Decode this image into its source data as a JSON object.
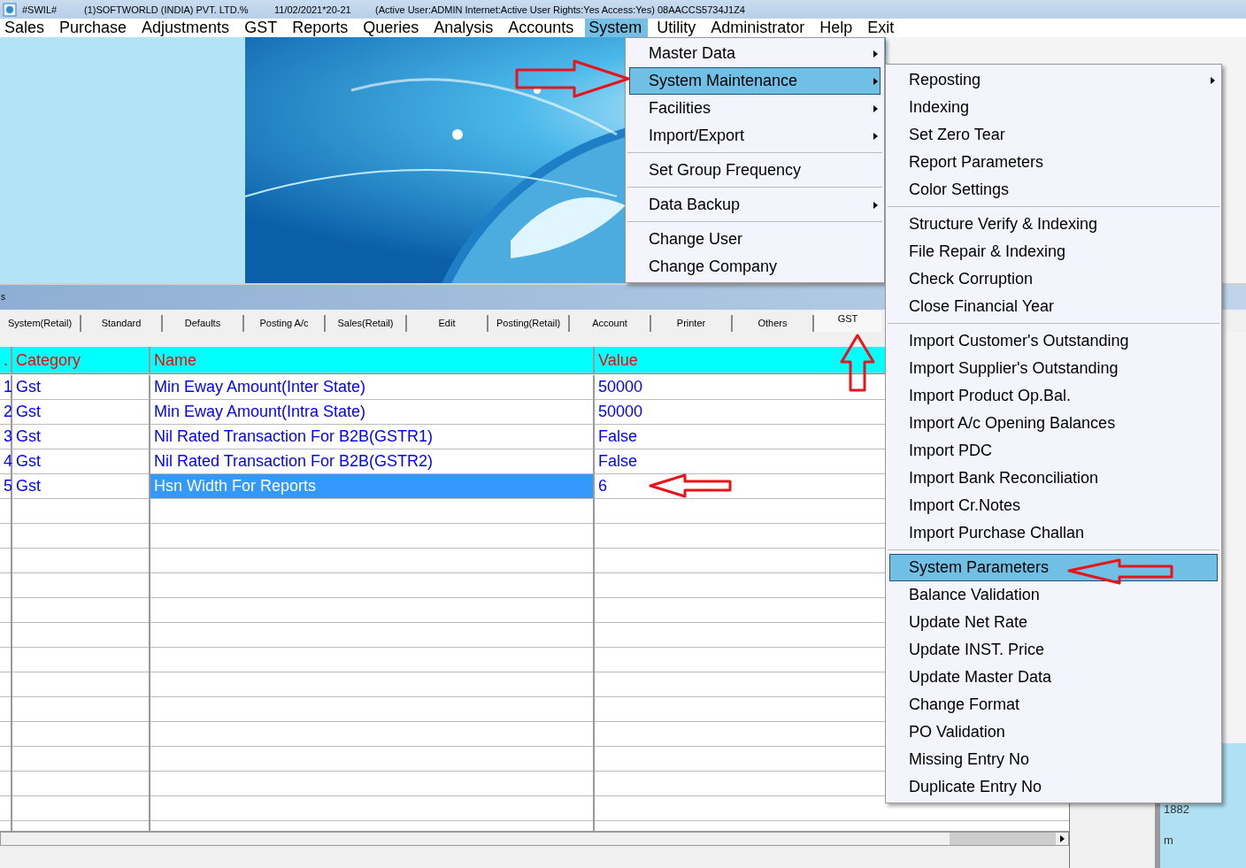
{
  "title_bar": {
    "app": "#SWIL#",
    "company": "(1)SOFTWORLD (INDIA) PVT. LTD.%",
    "date": "11/02/2021*20-21",
    "status": "(Active User:ADMIN Internet:Active  User Rights:Yes Access:Yes) 08AACCS5734J1Z4"
  },
  "menu_bar": [
    {
      "label": "Sales",
      "selected": false
    },
    {
      "label": "Purchase",
      "selected": false
    },
    {
      "label": "Adjustments",
      "selected": false
    },
    {
      "label": "GST",
      "selected": false
    },
    {
      "label": "Reports",
      "selected": false
    },
    {
      "label": "Queries",
      "selected": false
    },
    {
      "label": "Analysis",
      "selected": false
    },
    {
      "label": "Accounts",
      "selected": false
    },
    {
      "label": "System",
      "selected": true
    },
    {
      "label": "Utility",
      "selected": false
    },
    {
      "label": "Administrator",
      "selected": false
    },
    {
      "label": "Help",
      "selected": false
    },
    {
      "label": "Exit",
      "selected": false
    }
  ],
  "system_menu": [
    {
      "kind": "item",
      "label": "Master Data",
      "submenu": true,
      "selected": false
    },
    {
      "kind": "item",
      "label": "System Maintenance",
      "submenu": true,
      "selected": true
    },
    {
      "kind": "item",
      "label": "Facilities",
      "submenu": true,
      "selected": false
    },
    {
      "kind": "item",
      "label": "Import/Export",
      "submenu": true,
      "selected": false
    },
    {
      "kind": "separator"
    },
    {
      "kind": "item",
      "label": "Set Group Frequency",
      "submenu": false,
      "selected": false
    },
    {
      "kind": "separator"
    },
    {
      "kind": "item",
      "label": "Data Backup",
      "submenu": true,
      "selected": false
    },
    {
      "kind": "separator"
    },
    {
      "kind": "item",
      "label": "Change User",
      "submenu": false,
      "selected": false
    },
    {
      "kind": "item",
      "label": "Change Company",
      "submenu": false,
      "selected": false
    }
  ],
  "maintenance_menu": [
    {
      "kind": "item",
      "label": "Reposting",
      "submenu": true,
      "selected": false
    },
    {
      "kind": "item",
      "label": "Indexing",
      "submenu": false,
      "selected": false
    },
    {
      "kind": "item",
      "label": "Set Zero Tear",
      "submenu": false,
      "selected": false
    },
    {
      "kind": "item",
      "label": "Report Parameters",
      "submenu": false,
      "selected": false
    },
    {
      "kind": "item",
      "label": "Color Settings",
      "submenu": false,
      "selected": false
    },
    {
      "kind": "separator"
    },
    {
      "kind": "item",
      "label": "Structure Verify & Indexing",
      "submenu": false,
      "selected": false
    },
    {
      "kind": "item",
      "label": "File Repair & Indexing",
      "submenu": false,
      "selected": false
    },
    {
      "kind": "item",
      "label": "Check Corruption",
      "submenu": false,
      "selected": false
    },
    {
      "kind": "item",
      "label": "Close Financial Year",
      "submenu": false,
      "selected": false
    },
    {
      "kind": "separator"
    },
    {
      "kind": "item",
      "label": "Import Customer's Outstanding",
      "submenu": false,
      "selected": false
    },
    {
      "kind": "item",
      "label": "Import Supplier's Outstanding",
      "submenu": false,
      "selected": false
    },
    {
      "kind": "item",
      "label": "Import Product Op.Bal.",
      "submenu": false,
      "selected": false
    },
    {
      "kind": "item",
      "label": "Import A/c Opening Balances",
      "submenu": false,
      "selected": false
    },
    {
      "kind": "item",
      "label": "Import PDC",
      "submenu": false,
      "selected": false
    },
    {
      "kind": "item",
      "label": "Import Bank Reconciliation",
      "submenu": false,
      "selected": false
    },
    {
      "kind": "item",
      "label": "Import Cr.Notes",
      "submenu": false,
      "selected": false
    },
    {
      "kind": "item",
      "label": "Import Purchase Challan",
      "submenu": false,
      "selected": false
    },
    {
      "kind": "separator"
    },
    {
      "kind": "item",
      "label": "System Parameters",
      "submenu": false,
      "selected": true
    },
    {
      "kind": "item",
      "label": "Balance Validation",
      "submenu": false,
      "selected": false
    },
    {
      "kind": "item",
      "label": "Update Net Rate",
      "submenu": false,
      "selected": false
    },
    {
      "kind": "item",
      "label": "Update INST. Price",
      "submenu": false,
      "selected": false
    },
    {
      "kind": "item",
      "label": "Update Master Data",
      "submenu": false,
      "selected": false
    },
    {
      "kind": "item",
      "label": "Change Format",
      "submenu": false,
      "selected": false
    },
    {
      "kind": "item",
      "label": "PO Validation",
      "submenu": false,
      "selected": false
    },
    {
      "kind": "item",
      "label": "Missing Entry No",
      "submenu": false,
      "selected": false
    },
    {
      "kind": "item",
      "label": "Duplicate Entry No",
      "submenu": false,
      "selected": false
    }
  ],
  "panel_caption": "s",
  "tabs": [
    {
      "label": "System(Retail)",
      "selected": false
    },
    {
      "label": "Standard",
      "selected": false
    },
    {
      "label": "Defaults",
      "selected": false
    },
    {
      "label": "Posting A/c",
      "selected": false
    },
    {
      "label": "Sales(Retail)",
      "selected": false
    },
    {
      "label": "Edit",
      "selected": false
    },
    {
      "label": "Posting(Retail)",
      "selected": false
    },
    {
      "label": "Account",
      "selected": false
    },
    {
      "label": "Printer",
      "selected": false
    },
    {
      "label": "Others",
      "selected": false
    },
    {
      "label": "GST",
      "selected": true
    }
  ],
  "grid": {
    "columns": [
      ".",
      "Category",
      "Name",
      "Value"
    ],
    "rows": [
      {
        "no": "1",
        "category": "Gst",
        "name": "Min Eway Amount(Inter State)",
        "value": "50000",
        "selected": false
      },
      {
        "no": "2",
        "category": "Gst",
        "name": "Min Eway Amount(Intra State)",
        "value": "50000",
        "selected": false
      },
      {
        "no": "3",
        "category": "Gst",
        "name": "Nil Rated Transaction For B2B(GSTR1)",
        "value": "False",
        "selected": false
      },
      {
        "no": "4",
        "category": "Gst",
        "name": "Nil Rated Transaction For B2B(GSTR2)",
        "value": "False",
        "selected": false
      },
      {
        "no": "5",
        "category": "Gst",
        "name": "Hsn Width For Reports",
        "value": "6",
        "selected": true
      }
    ]
  },
  "side_panel": {
    "texts": [
      "1882",
      "m"
    ]
  }
}
